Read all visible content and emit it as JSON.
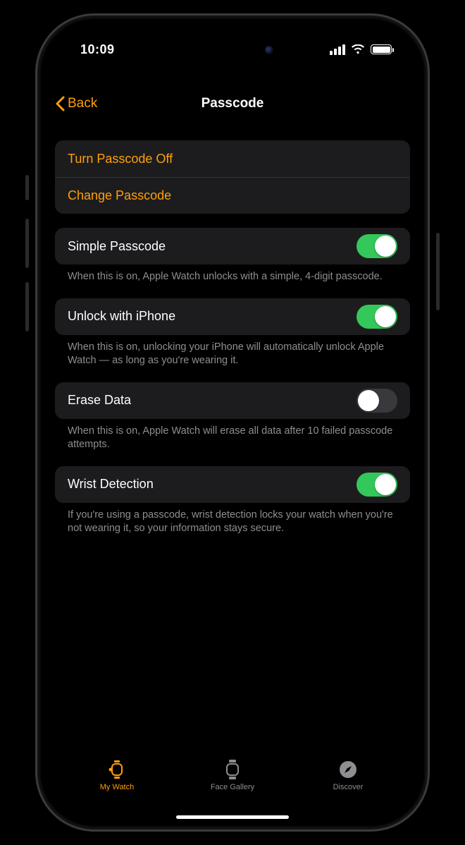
{
  "status": {
    "time": "10:09"
  },
  "nav": {
    "back_label": "Back",
    "title": "Passcode"
  },
  "actions": {
    "turn_off": "Turn Passcode Off",
    "change": "Change Passcode"
  },
  "settings": [
    {
      "key": "simple",
      "label": "Simple Passcode",
      "on": true,
      "note": "When this is on, Apple Watch unlocks with a simple, 4-digit passcode."
    },
    {
      "key": "unlock",
      "label": "Unlock with iPhone",
      "on": true,
      "note": "When this is on, unlocking your iPhone will automatically unlock Apple Watch — as long as you're wearing it."
    },
    {
      "key": "erase",
      "label": "Erase Data",
      "on": false,
      "note": "When this is on, Apple Watch will erase all data after 10 failed passcode attempts."
    },
    {
      "key": "wrist",
      "label": "Wrist Detection",
      "on": true,
      "note": "If you're using a passcode, wrist detection locks your watch when you're not wearing it, so your information stays secure."
    }
  ],
  "tabs": {
    "my_watch": "My Watch",
    "face_gallery": "Face Gallery",
    "discover": "Discover"
  },
  "colors": {
    "accent": "#ff9f0a",
    "toggle_on": "#34c759",
    "cell_bg": "#1c1c1e",
    "secondary_text": "#8e8e93"
  }
}
